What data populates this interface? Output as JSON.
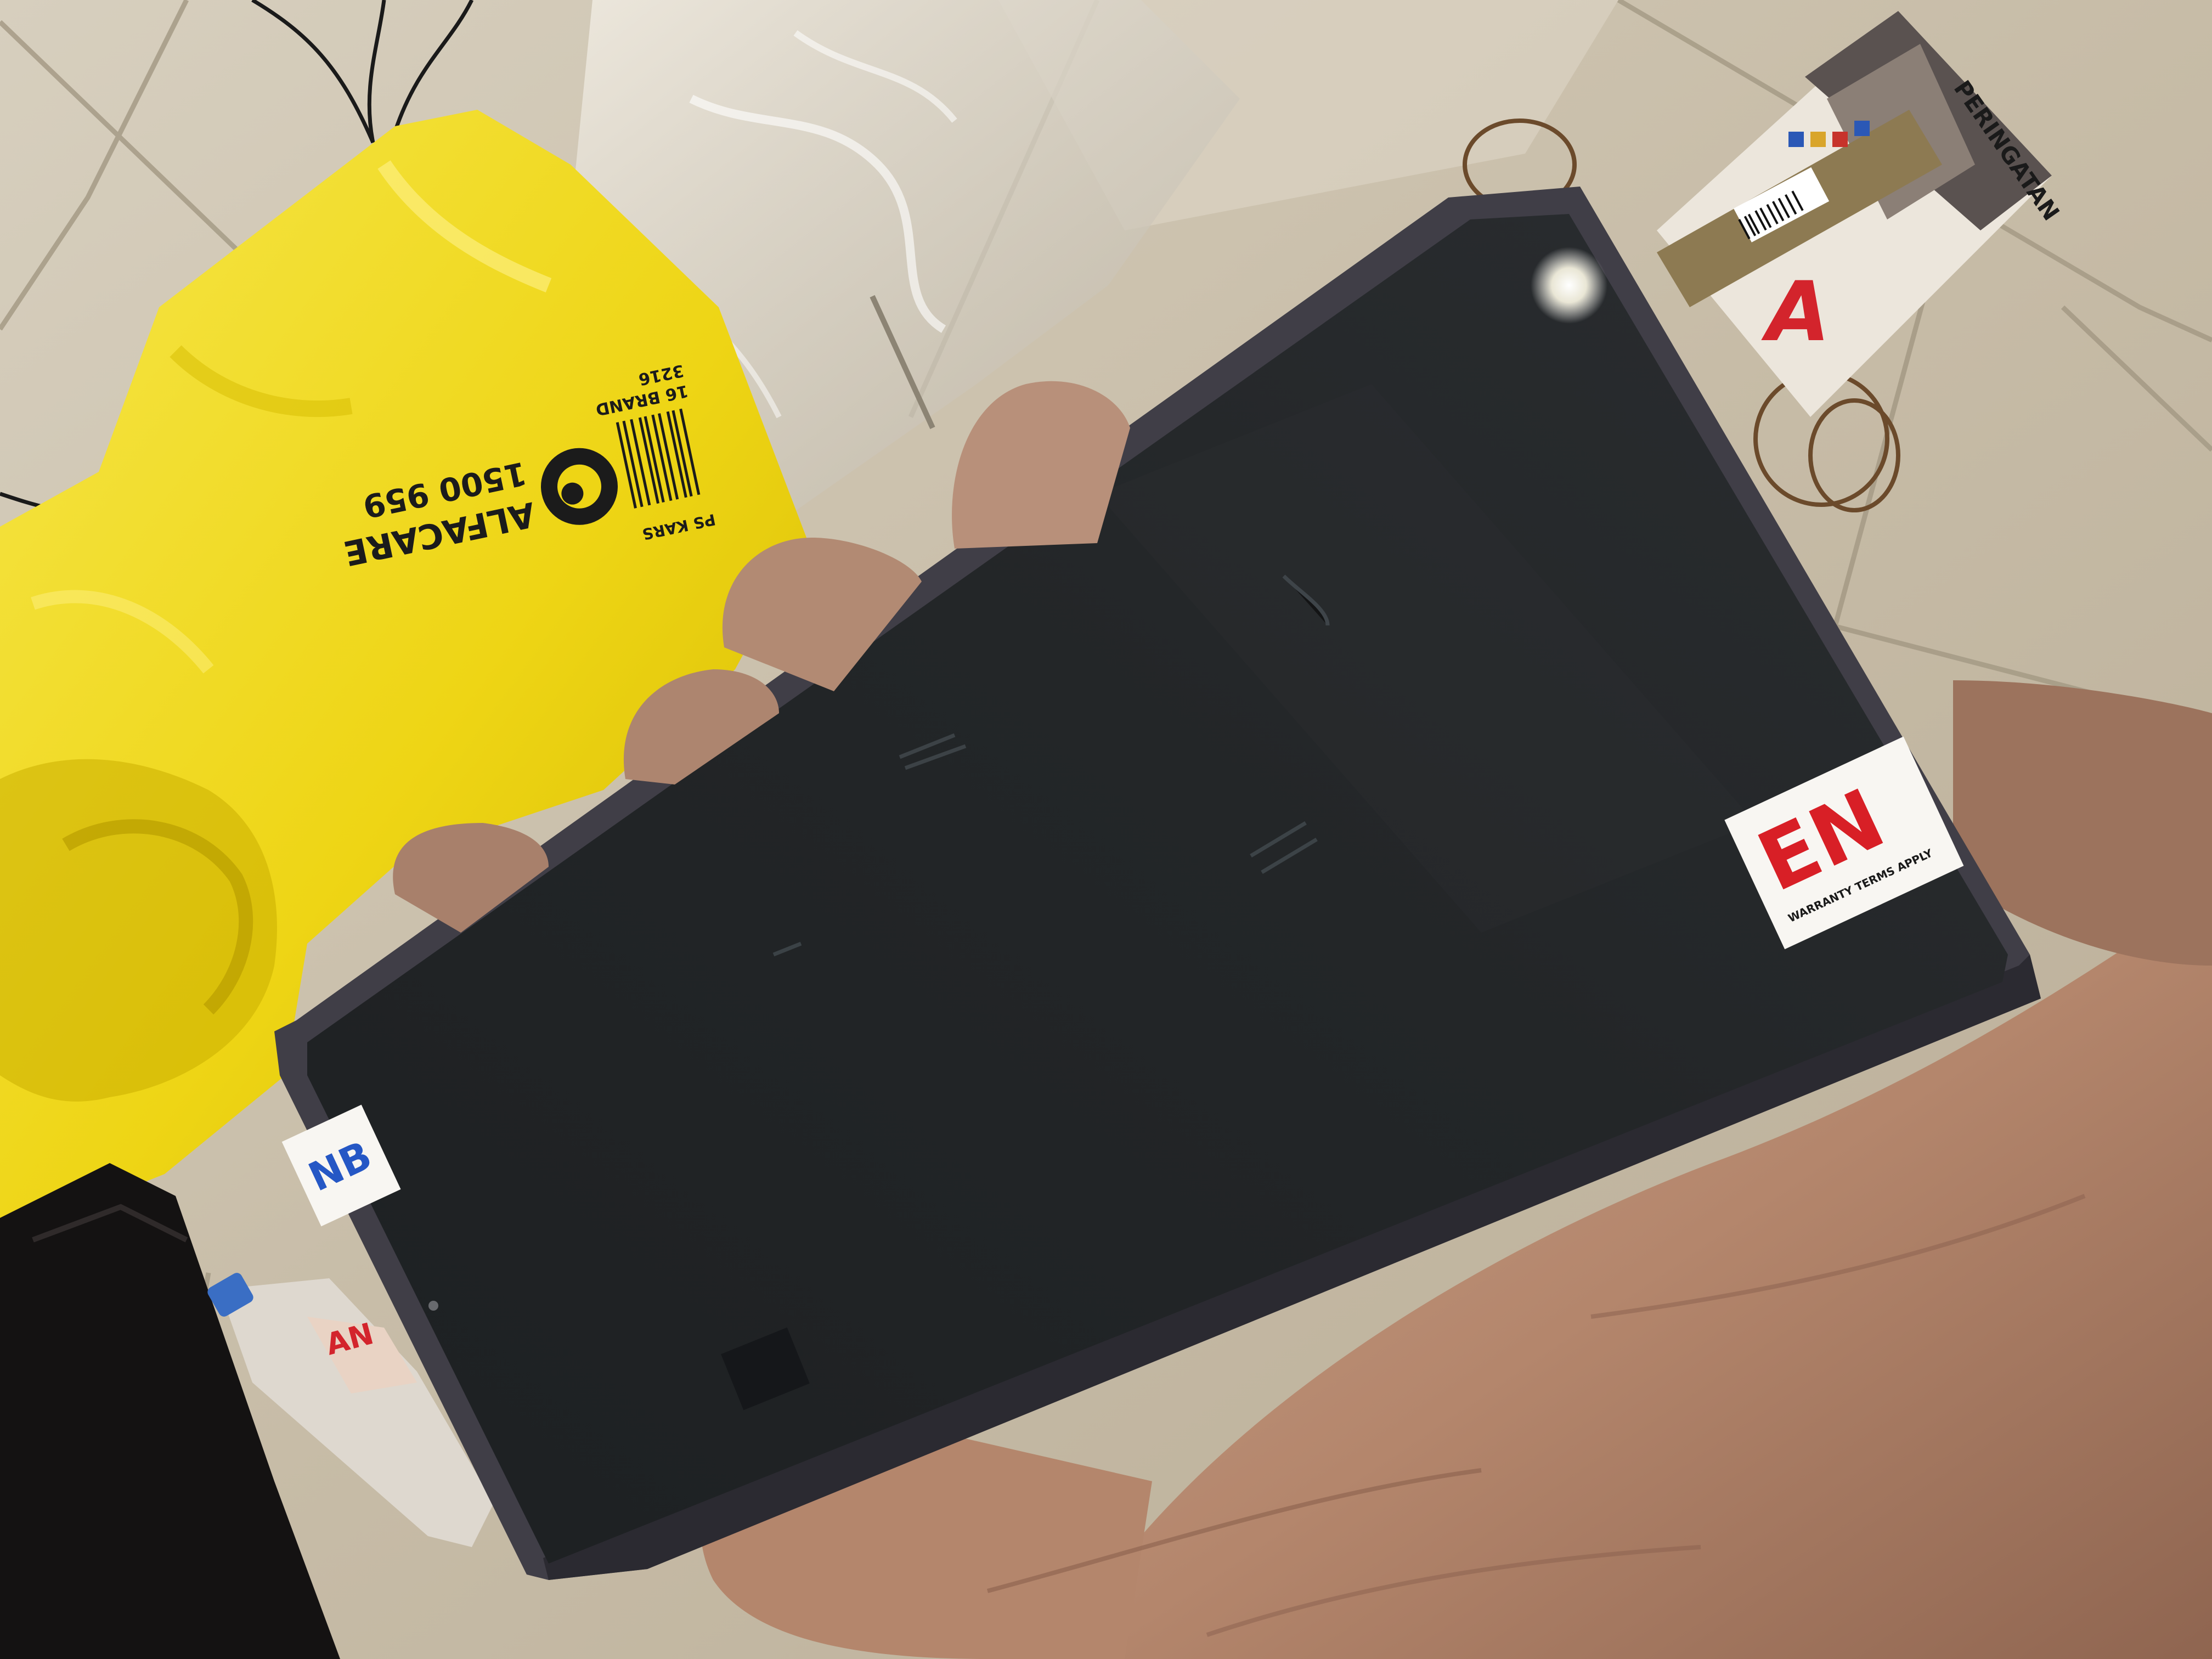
{
  "bag": {
    "brand": "ALFACARE",
    "phone": "1500 959",
    "code_top": "PS KARS",
    "code_mid": "16 BRAND",
    "code_bot": "3216"
  },
  "box": {
    "side_text": "PERINGATAN",
    "front_text": "A"
  },
  "stickers": {
    "right_logo": "EN",
    "right_caption": "WARRANTY TERMS APPLY",
    "left_logo": "NB"
  },
  "bottle": {
    "label": "AN"
  },
  "colors": {
    "floor": "#c9c0ae",
    "bag": "#f0dc1a",
    "phone_frame": "#3e3c44",
    "screen": "#212426",
    "skin": "#b58a6f",
    "sticker_red": "#d81f26"
  }
}
